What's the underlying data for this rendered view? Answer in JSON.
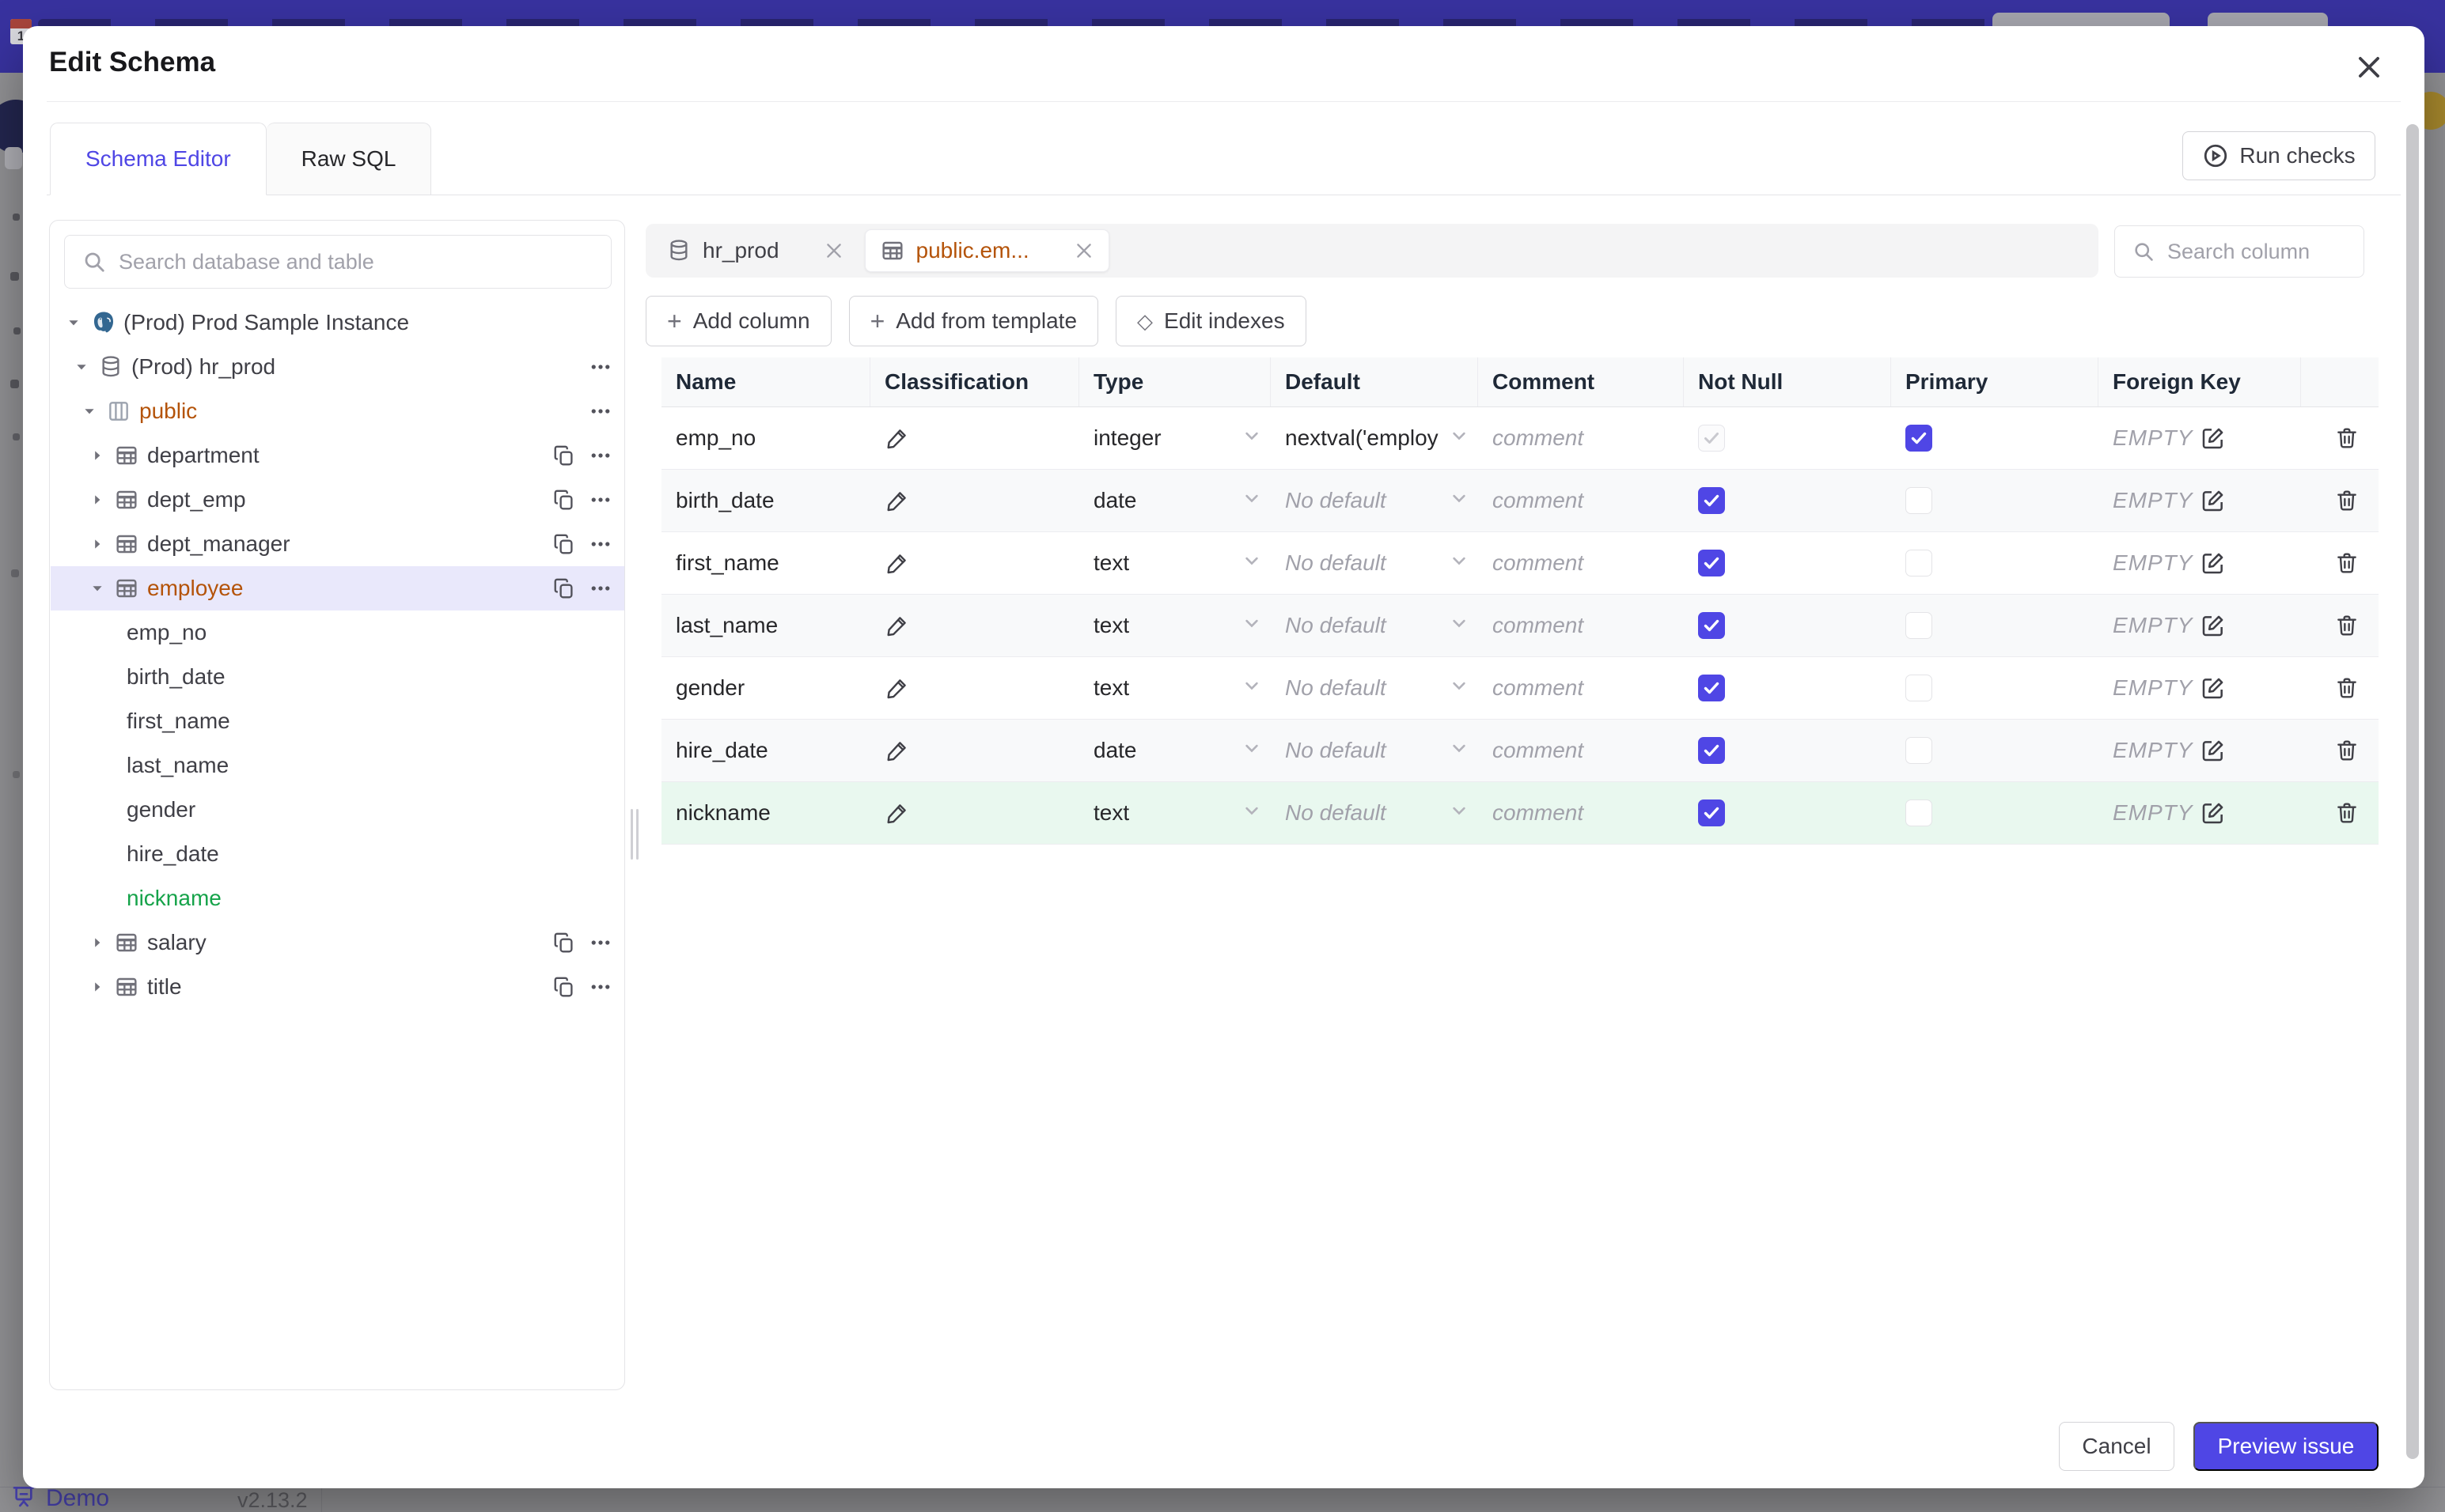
{
  "colors": {
    "accent": "#4f46e5",
    "amber_text": "#b45309",
    "green_text": "#16a34a",
    "selected_tree_bg": "#e9e8fb",
    "new_row_bg": "#e9f8ef",
    "header_purple": "#38329f",
    "backdrop": "#929295"
  },
  "page": {
    "footer": {
      "demo_label": "Demo",
      "version": "v2.13.2"
    }
  },
  "modal": {
    "title": "Edit Schema",
    "tabs": [
      {
        "label": "Schema Editor",
        "active": true
      },
      {
        "label": "Raw SQL",
        "active": false
      }
    ],
    "run_checks_label": "Run checks",
    "sidebar": {
      "search_placeholder": "Search database and table",
      "tree": [
        {
          "level": 0,
          "caret": "down",
          "icon": "postgres",
          "label": "(Prod) Prod Sample Instance",
          "actions": []
        },
        {
          "level": 1,
          "caret": "down",
          "icon": "database",
          "label": "(Prod) hr_prod",
          "actions": [
            "more"
          ]
        },
        {
          "level": 2,
          "caret": "down",
          "icon": "schema",
          "label": "public",
          "accent": "amber",
          "actions": [
            "more"
          ]
        },
        {
          "level": 3,
          "caret": "right",
          "icon": "table",
          "label": "department",
          "actions": [
            "copy",
            "more"
          ]
        },
        {
          "level": 3,
          "caret": "right",
          "icon": "table",
          "label": "dept_emp",
          "actions": [
            "copy",
            "more"
          ]
        },
        {
          "level": 3,
          "caret": "right",
          "icon": "table",
          "label": "dept_manager",
          "actions": [
            "copy",
            "more"
          ]
        },
        {
          "level": 3,
          "caret": "down",
          "icon": "table",
          "label": "employee",
          "accent": "amber",
          "selected": true,
          "actions": [
            "copy",
            "more"
          ]
        },
        {
          "level": 4,
          "label": "emp_no"
        },
        {
          "level": 4,
          "label": "birth_date"
        },
        {
          "level": 4,
          "label": "first_name"
        },
        {
          "level": 4,
          "label": "last_name"
        },
        {
          "level": 4,
          "label": "gender"
        },
        {
          "level": 4,
          "label": "hire_date"
        },
        {
          "level": 4,
          "label": "nickname",
          "accent": "green"
        },
        {
          "level": 3,
          "caret": "right",
          "icon": "table",
          "label": "salary",
          "actions": [
            "copy",
            "more"
          ]
        },
        {
          "level": 3,
          "caret": "right",
          "icon": "table",
          "label": "title",
          "actions": [
            "copy",
            "more"
          ]
        }
      ]
    },
    "editor": {
      "open_tabs": [
        {
          "icon": "database",
          "label": "hr_prod",
          "active": false
        },
        {
          "icon": "table",
          "label": "public.em...",
          "active": true
        }
      ],
      "column_search_placeholder": "Search column",
      "toolbar": [
        {
          "icon": "plus",
          "label": "Add column"
        },
        {
          "icon": "plus",
          "label": "Add from template"
        },
        {
          "icon": "diamond",
          "label": "Edit indexes"
        }
      ],
      "table": {
        "headers": [
          "Name",
          "Classification",
          "Type",
          "Default",
          "Comment",
          "Not Null",
          "Primary",
          "Foreign Key",
          ""
        ],
        "comment_placeholder": "comment",
        "foreign_key_empty_label": "EMPTY",
        "rows": [
          {
            "name": "emp_no",
            "type": "integer",
            "default": "nextval('employ",
            "default_is_placeholder": false,
            "not_null": true,
            "not_null_disabled": true,
            "primary": true,
            "highlight": false
          },
          {
            "name": "birth_date",
            "type": "date",
            "default": "No default",
            "default_is_placeholder": true,
            "not_null": true,
            "not_null_disabled": false,
            "primary": false,
            "highlight": false
          },
          {
            "name": "first_name",
            "type": "text",
            "default": "No default",
            "default_is_placeholder": true,
            "not_null": true,
            "not_null_disabled": false,
            "primary": false,
            "highlight": false
          },
          {
            "name": "last_name",
            "type": "text",
            "default": "No default",
            "default_is_placeholder": true,
            "not_null": true,
            "not_null_disabled": false,
            "primary": false,
            "highlight": false
          },
          {
            "name": "gender",
            "type": "text",
            "default": "No default",
            "default_is_placeholder": true,
            "not_null": true,
            "not_null_disabled": false,
            "primary": false,
            "highlight": false
          },
          {
            "name": "hire_date",
            "type": "date",
            "default": "No default",
            "default_is_placeholder": true,
            "not_null": true,
            "not_null_disabled": false,
            "primary": false,
            "highlight": false
          },
          {
            "name": "nickname",
            "type": "text",
            "default": "No default",
            "default_is_placeholder": true,
            "not_null": true,
            "not_null_disabled": false,
            "primary": false,
            "highlight": true
          }
        ]
      }
    },
    "footer": {
      "cancel_label": "Cancel",
      "primary_label": "Preview issue"
    }
  }
}
